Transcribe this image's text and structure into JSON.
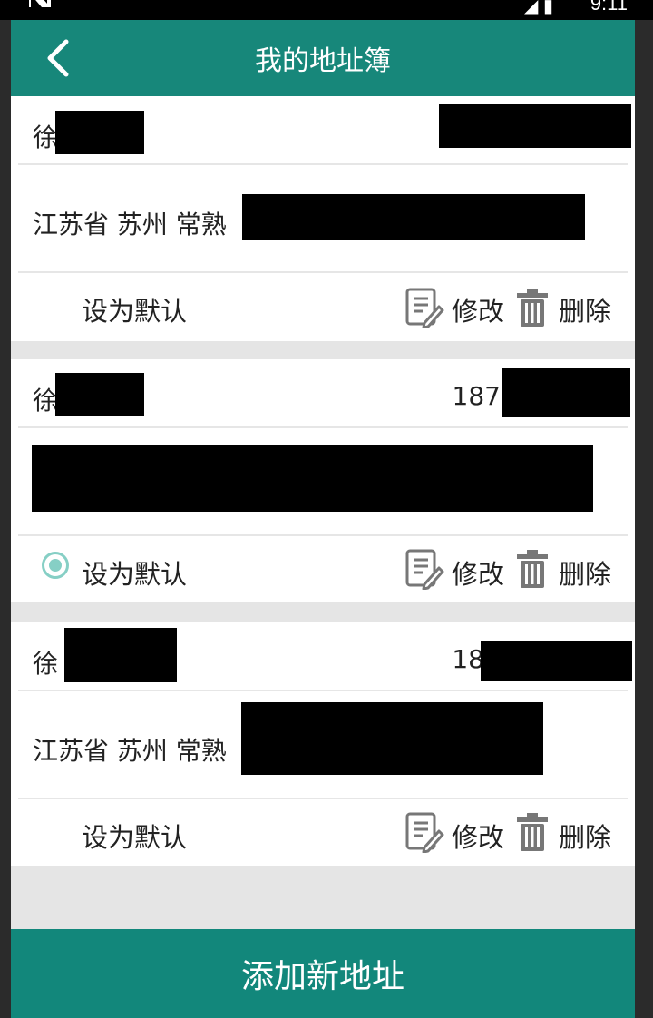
{
  "status_bar": {
    "time": "9:11"
  },
  "header": {
    "title": "我的地址簿",
    "back_icon": "chevron-left-icon"
  },
  "addresses": [
    {
      "name": "徐",
      "phone": "",
      "address": "江苏省 苏州 常熟",
      "is_default": false,
      "default_label": "设为默认",
      "edit_label": "修改",
      "delete_label": "删除"
    },
    {
      "name": "徐",
      "phone": "187",
      "address": "",
      "is_default": true,
      "default_label": "设为默认",
      "edit_label": "修改",
      "delete_label": "删除"
    },
    {
      "name": "徐",
      "phone": "18",
      "address": "江苏省 苏州 常熟",
      "is_default": false,
      "default_label": "设为默认",
      "edit_label": "修改",
      "delete_label": "删除"
    }
  ],
  "footer": {
    "add_label": "添加新地址"
  },
  "colors": {
    "primary": "#17877a",
    "radio": "#86cfc5",
    "background": "#e5e5e5"
  }
}
